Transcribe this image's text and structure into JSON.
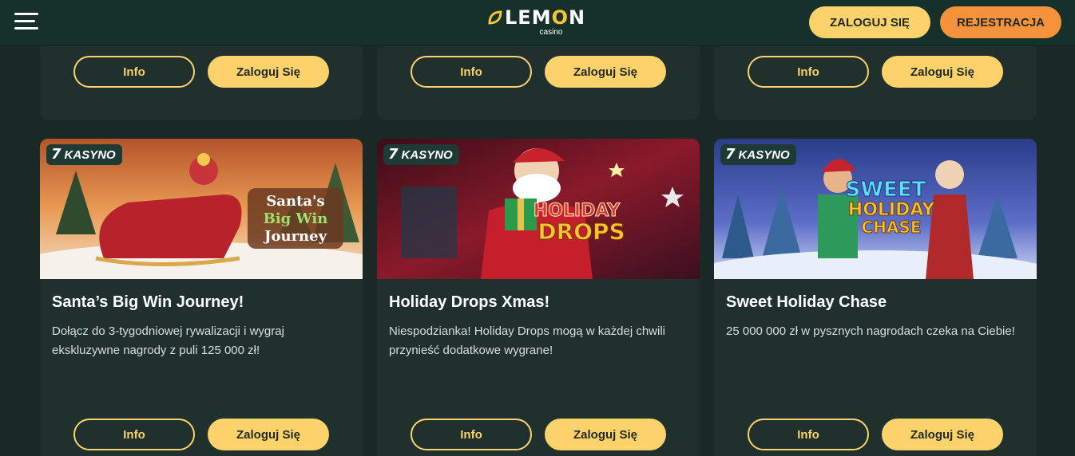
{
  "header": {
    "logo_text_a": "LEM",
    "logo_text_o": "O",
    "logo_text_b": "N",
    "logo_sub": "casino",
    "login_label": "ZALOGUJ SIĘ",
    "register_label": "REJESTRACJA"
  },
  "top_cards": [
    {
      "info_label": "Info",
      "login_label": "Zaloguj Się"
    },
    {
      "info_label": "Info",
      "login_label": "Zaloguj Się"
    },
    {
      "info_label": "Info",
      "login_label": "Zaloguj Się"
    }
  ],
  "promos": [
    {
      "badge_icon": "7",
      "badge": "KASYNO",
      "banner_text_1": "Santa's",
      "banner_text_2": "Big Win",
      "banner_text_3": "Journey",
      "title": "Santa’s Big Win Journey!",
      "description": "Dołącz do 3-tygodniowej rywalizacji i wygraj ekskluzywne nagrody z puli 125 000 zł!",
      "info_label": "Info",
      "login_label": "Zaloguj Się"
    },
    {
      "badge_icon": "7",
      "badge": "KASYNO",
      "banner_text_1": "HOLIDAY",
      "banner_text_2": "DROPS",
      "title": "Holiday Drops Xmas!",
      "description": "Niespodzianka! Holiday Drops mogą w każdej chwili przynieść dodatkowe wygrane!",
      "info_label": "Info",
      "login_label": "Zaloguj Się"
    },
    {
      "badge_icon": "7",
      "badge": "KASYNO",
      "banner_text_1": "SWEET",
      "banner_text_2": "HOLIDAY",
      "banner_text_3": "CHASE",
      "title": "Sweet Holiday Chase",
      "description": "25 000 000 zł w pysznych nagrodach czeka na Ciebie!",
      "info_label": "Info",
      "login_label": "Zaloguj Się"
    }
  ],
  "icons": {
    "menu": "hamburger-menu-icon",
    "logo": "lemon-leaf-icon"
  },
  "colors": {
    "background": "#1a2826",
    "header": "#16302c",
    "card": "#1f302d",
    "accent_yellow": "#fed26a",
    "accent_orange": "#f5923b"
  }
}
